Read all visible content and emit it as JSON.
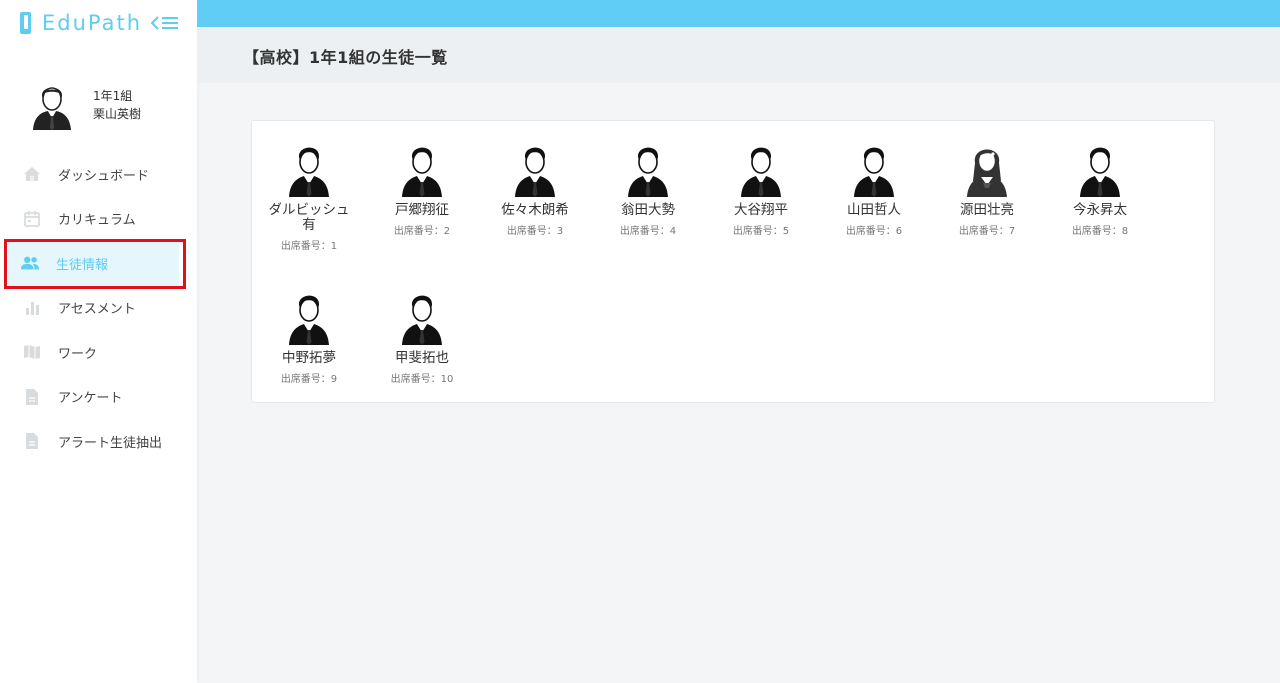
{
  "brand": {
    "name": "EduPath"
  },
  "profile": {
    "class_label": "1年1組",
    "teacher_name": "栗山英樹"
  },
  "nav": {
    "items": [
      {
        "label": "ダッシュボード",
        "icon": "home-icon"
      },
      {
        "label": "カリキュラム",
        "icon": "calendar-icon"
      },
      {
        "label": "生徒情報",
        "icon": "people-icon",
        "active": true
      },
      {
        "label": "アセスメント",
        "icon": "bar-chart-icon"
      },
      {
        "label": "ワーク",
        "icon": "book-icon"
      },
      {
        "label": "アンケート",
        "icon": "document-icon"
      },
      {
        "label": "アラート生徒抽出",
        "icon": "document-icon"
      }
    ]
  },
  "page": {
    "title": "【高校】1年1組の生徒一覧"
  },
  "students": [
    {
      "name": "ダルビッシュ有",
      "number_label": "出席番号：1",
      "gender": "male"
    },
    {
      "name": "戸郷翔征",
      "number_label": "出席番号：2",
      "gender": "male"
    },
    {
      "name": "佐々木朗希",
      "number_label": "出席番号：3",
      "gender": "male"
    },
    {
      "name": "翁田大勢",
      "number_label": "出席番号：4",
      "gender": "male"
    },
    {
      "name": "大谷翔平",
      "number_label": "出席番号：5",
      "gender": "male"
    },
    {
      "name": "山田哲人",
      "number_label": "出席番号：6",
      "gender": "male"
    },
    {
      "name": "源田壮亮",
      "number_label": "出席番号：7",
      "gender": "female"
    },
    {
      "name": "今永昇太",
      "number_label": "出席番号：8",
      "gender": "male"
    },
    {
      "name": "中野拓夢",
      "number_label": "出席番号：9",
      "gender": "male"
    },
    {
      "name": "甲斐拓也",
      "number_label": "出席番号：10",
      "gender": "male"
    }
  ],
  "colors": {
    "accent": "#5fcdf6",
    "active_bg": "#e6f6fd",
    "highlight": "#e2101b"
  }
}
